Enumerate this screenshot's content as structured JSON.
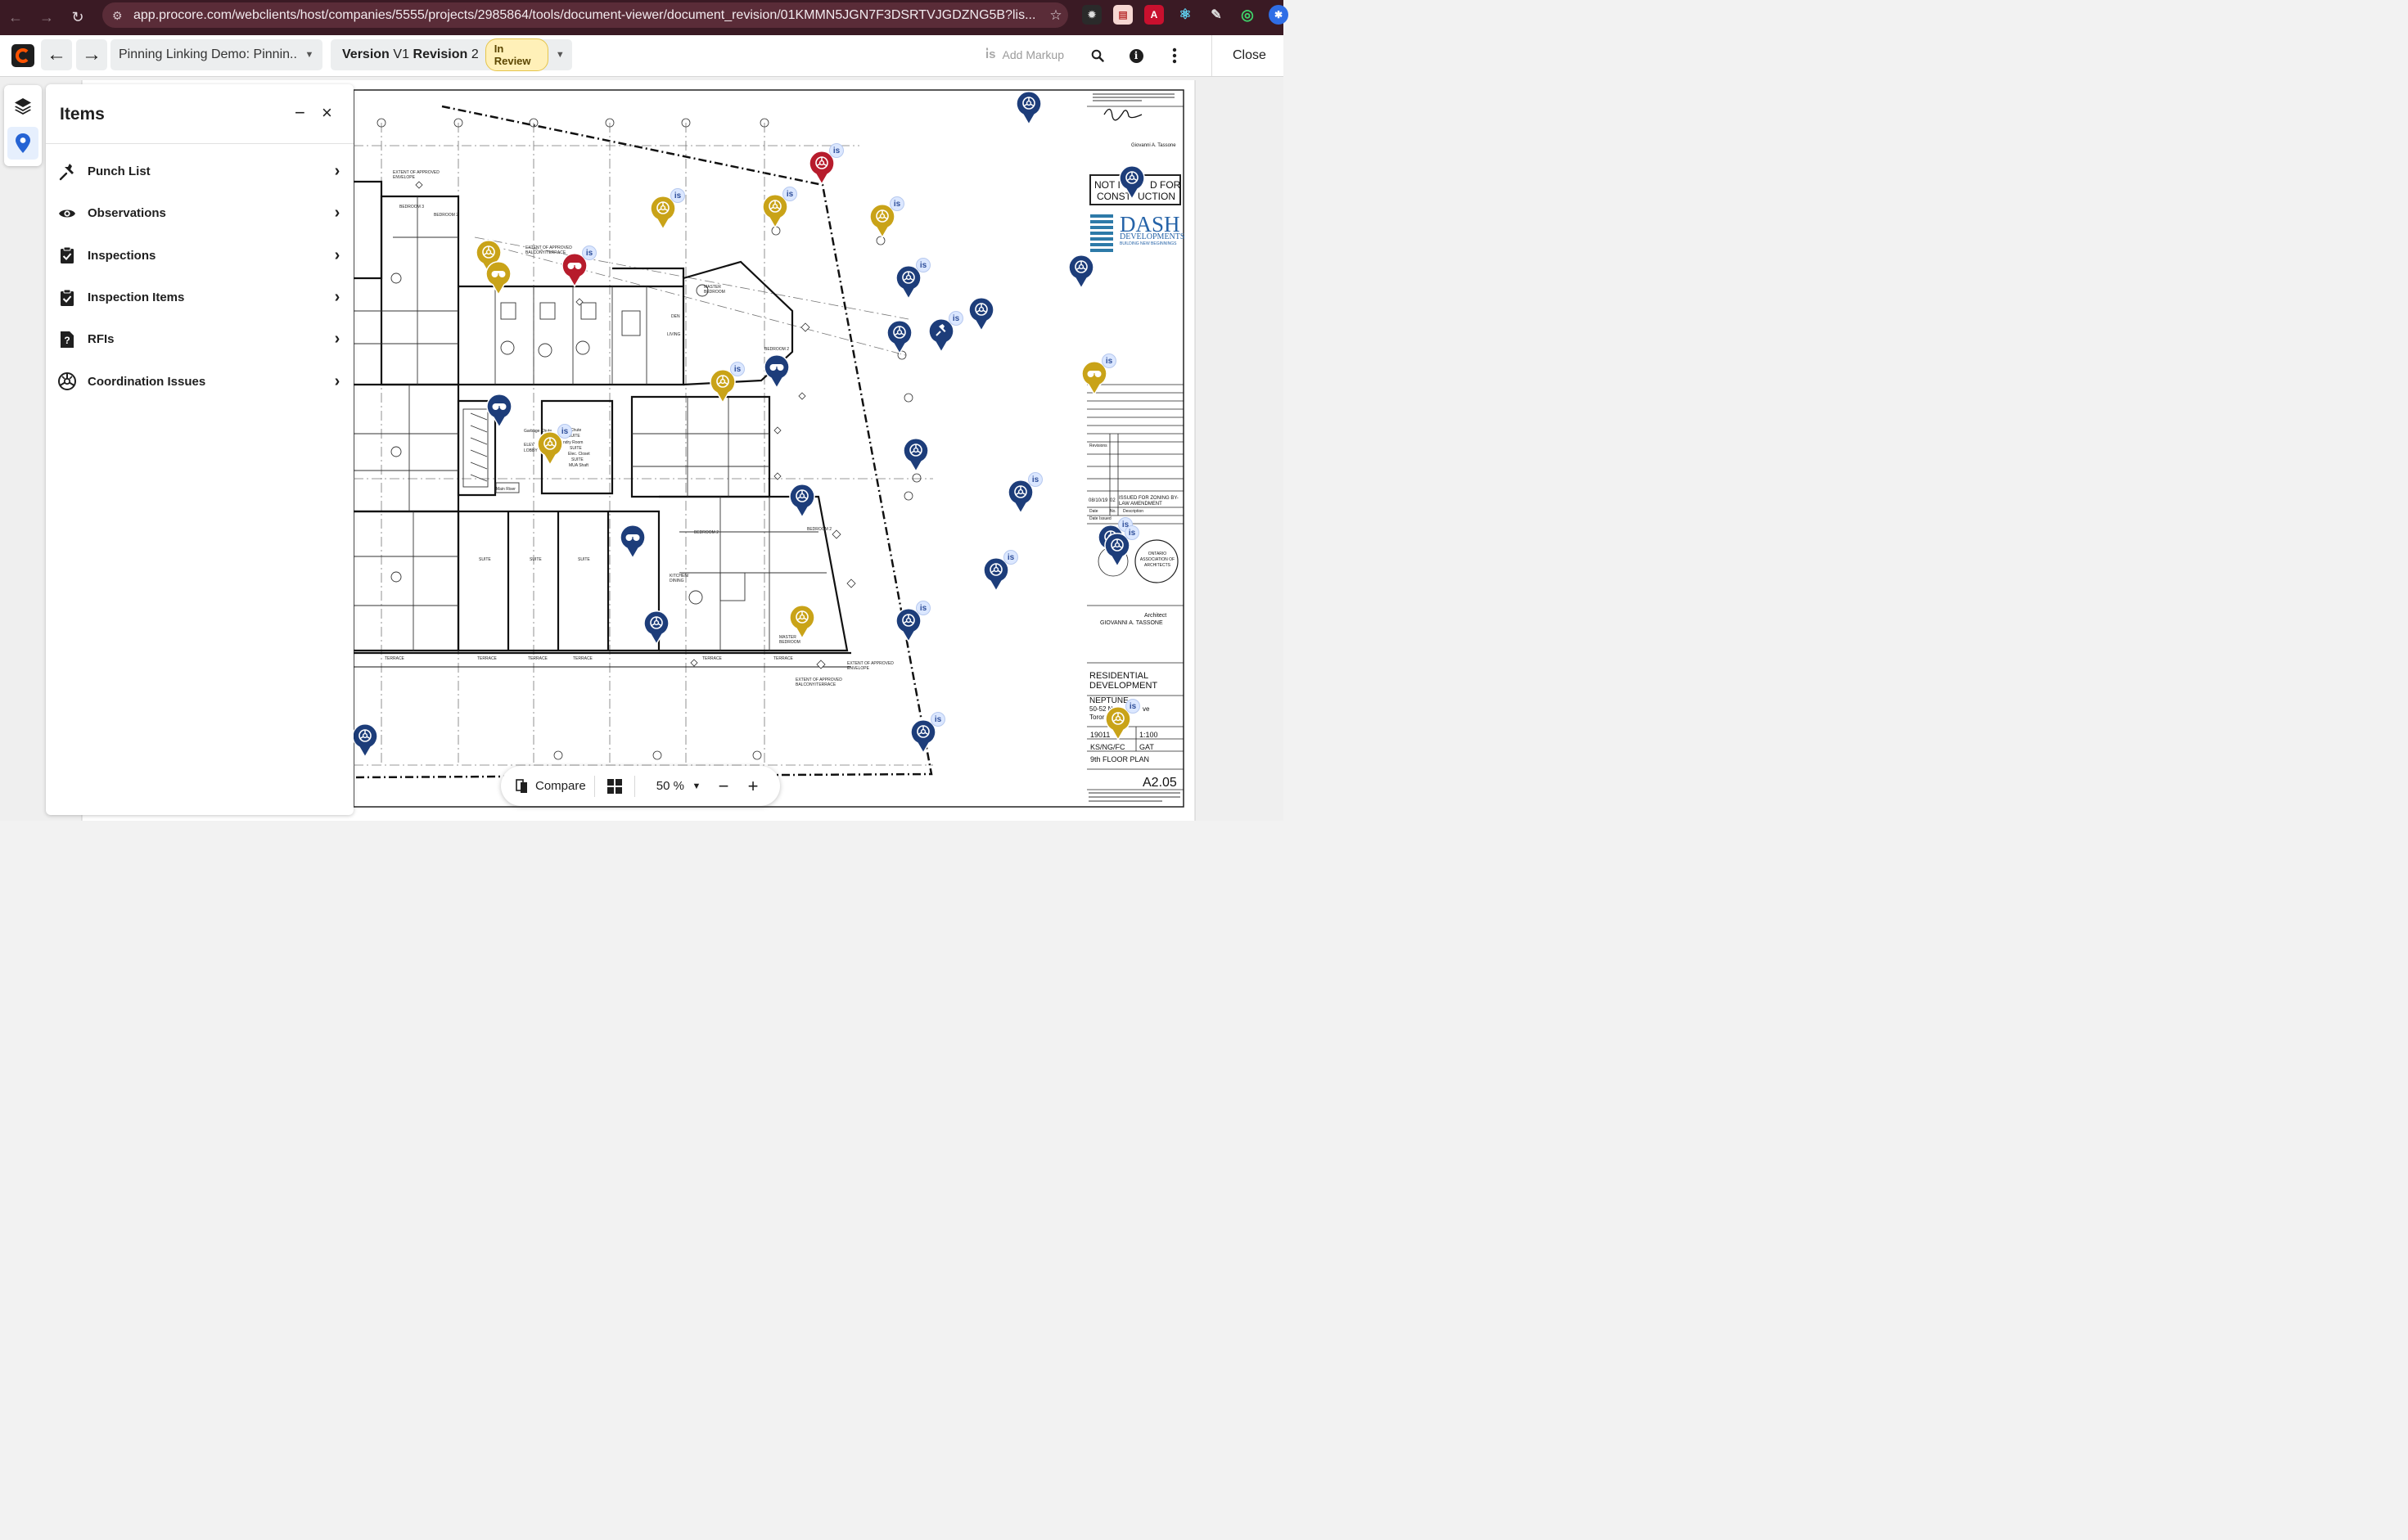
{
  "browser": {
    "url": "app.procore.com/webclients/host/companies/5555/projects/2985864/tools/document-viewer/document_revision/01KMMN5JGN7F3DSRTVJGDZNG5B?lis...",
    "extensions": [
      "gear-ext",
      "doc-ext",
      "pdf-ext",
      "react-ext",
      "eyedropper-ext",
      "chrome-ext",
      "profile-ext"
    ]
  },
  "toolbar": {
    "document_name": "Pinning Linking Demo: Pinnin...",
    "version_label": "Version",
    "version_value": "V1",
    "revision_label": "Revision",
    "revision_value": "2",
    "status": "In Review",
    "add_markup": "Add Markup",
    "close": "Close"
  },
  "panel": {
    "title": "Items",
    "minimize": "−",
    "close": "×",
    "items": [
      {
        "label": "Punch List",
        "icon": "punch-list-icon"
      },
      {
        "label": "Observations",
        "icon": "observation-eye-icon"
      },
      {
        "label": "Inspections",
        "icon": "clipboard-check-icon"
      },
      {
        "label": "Inspection Items",
        "icon": "clipboard-check-icon"
      },
      {
        "label": "RFIs",
        "icon": "rfi-question-icon"
      },
      {
        "label": "Coordination Issues",
        "icon": "coordination-issue-icon"
      }
    ]
  },
  "bottom": {
    "compare": "Compare",
    "zoom": "50 %",
    "zoom_out": "−",
    "zoom_in": "+"
  },
  "title_block": {
    "architect_name": "Giovanni A. Tassone",
    "stamp_line1": "NOT I",
    "stamp_line1b": "D FOR",
    "stamp_line2": "CONST",
    "stamp_line2b": "UCTION",
    "company": "DASH",
    "company_sub": "DEVELOPMENTS",
    "company_tag": "BUILDING NEW BEGINNINGS",
    "revisions_label": "Revisions",
    "issue_date": "08/10/19",
    "issue_no": "02",
    "issue_desc": "ISSUED FOR ZONING BY-LAW AMENDMENT",
    "col_date": "Date",
    "col_no": "No.",
    "col_desc": "Description",
    "date_issued": "Date Issued",
    "seal_text": "ONTARIO ASSOCIATION OF ARCHITECTS",
    "architect_label": "Architect",
    "architect_firm": "GIOVANNI A. TASSONE",
    "project_line1": "RESIDENTIAL",
    "project_line2": "DEVELOPMENT",
    "site_line1": "NEPTUNE",
    "site_line2": "50-52 N",
    "site_line2b": "ve",
    "site_line3": "Toror",
    "project_no": "19011",
    "scale": "1:100",
    "drawn_by": "KS/NG/FC",
    "checked_by": "GAT",
    "sheet_title": "9th FLOOR PLAN",
    "sheet_no": "A2.05"
  },
  "colors": {
    "browser_bg": "#3a1a24",
    "pin_blue": "#1d3d7a",
    "pin_gold": "#c9a318",
    "pin_red": "#b71c2c",
    "status_bg": "#fff0b8",
    "accent_blue": "#2563d4"
  }
}
